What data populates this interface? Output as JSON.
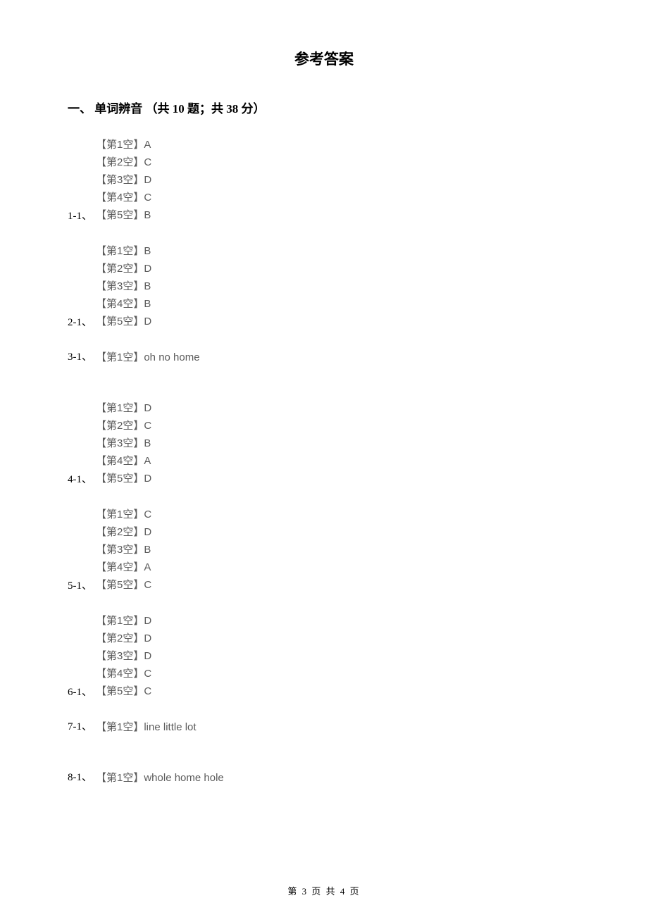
{
  "title": "参考答案",
  "section_header": "一、 单词辨音 （共 10 题；共 38 分）",
  "groups": [
    {
      "label": "1-1、",
      "type": "multi",
      "items": [
        "【第1空】A",
        "【第2空】C",
        "【第3空】D",
        "【第4空】C",
        "【第5空】B"
      ]
    },
    {
      "label": "2-1、",
      "type": "multi",
      "items": [
        "【第1空】B",
        "【第2空】D",
        "【第3空】B",
        "【第4空】B",
        "【第5空】D"
      ]
    },
    {
      "label": "3-1、",
      "type": "single",
      "items": [
        "【第1空】oh  no  home"
      ]
    },
    {
      "label": "4-1、",
      "type": "multi",
      "items": [
        "【第1空】D",
        "【第2空】C",
        "【第3空】B",
        "【第4空】A",
        "【第5空】D"
      ]
    },
    {
      "label": "5-1、",
      "type": "multi",
      "items": [
        "【第1空】C",
        "【第2空】D",
        "【第3空】B",
        "【第4空】A",
        "【第5空】C"
      ]
    },
    {
      "label": "6-1、",
      "type": "multi",
      "items": [
        "【第1空】D",
        "【第2空】D",
        "【第3空】D",
        "【第4空】C",
        "【第5空】C"
      ]
    },
    {
      "label": "7-1、",
      "type": "single",
      "items": [
        "【第1空】line little lot"
      ]
    },
    {
      "label": "8-1、",
      "type": "single",
      "items": [
        "【第1空】whole home hole"
      ]
    }
  ],
  "footer": "第 3 页 共 4 页"
}
